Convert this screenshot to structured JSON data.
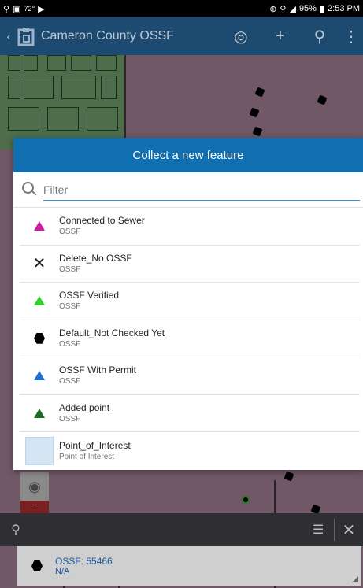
{
  "status_bar": {
    "temp": "72°",
    "battery": "95%",
    "time": "2:53 PM"
  },
  "app_bar": {
    "title": "Cameron County OSSF"
  },
  "dialog": {
    "title": "Collect a new feature",
    "filter_placeholder": "Filter",
    "items": [
      {
        "name": "Connected to Sewer",
        "layer": "OSSF",
        "symbol": "triangle",
        "color": "#d31aa6"
      },
      {
        "name": "Delete_No OSSF",
        "layer": "OSSF",
        "symbol": "x",
        "color": "#222222"
      },
      {
        "name": "OSSF Verified",
        "layer": "OSSF",
        "symbol": "triangle",
        "color": "#2fd12a"
      },
      {
        "name": "Default_Not Checked Yet",
        "layer": "OSSF",
        "symbol": "hexagon",
        "color": "#000000"
      },
      {
        "name": "OSSF With Permit",
        "layer": "OSSF",
        "symbol": "triangle",
        "color": "#1e6fd8"
      },
      {
        "name": "Added point",
        "layer": "OSSF",
        "symbol": "triangle",
        "color": "#1f6b20"
      },
      {
        "name": "Point_of_Interest",
        "layer": "Point of Interest",
        "symbol": "swatch",
        "color": "#d4e6f4"
      }
    ]
  },
  "selected_feature": {
    "title": "OSSF: 55466",
    "subtitle": "N/A"
  }
}
